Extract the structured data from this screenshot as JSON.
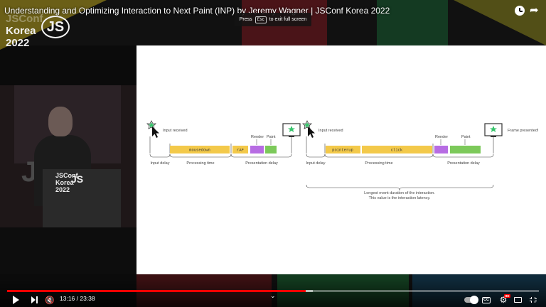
{
  "video": {
    "title": "Understanding and Optimizing Interaction to Next Paint (INP) by Jeremy Wagner | JSConf Korea 2022",
    "time": "13:16 / 23:38",
    "progress_played": 0.561,
    "progress_loaded": 0.575
  },
  "toast": {
    "press": "Press",
    "key": "Esc",
    "suffix": "to exit full screen"
  },
  "branding": {
    "logo_line1": "JSConf",
    "logo_line2": "Korea",
    "logo_line3": "2022",
    "logo_js": "JS"
  },
  "diagram": {
    "left": {
      "input_received": "Input received",
      "events": [
        "mousedown"
      ],
      "raf": "rAF",
      "render": "Render",
      "paint": "Paint",
      "input_delay": "Input delay",
      "processing_time": "Processing time",
      "presentation_delay": "Presentation delay"
    },
    "right": {
      "input_received": "Input received",
      "events": [
        "pointerup",
        "click"
      ],
      "render": "Render",
      "paint": "Paint",
      "frame_presented": "Frame presented!",
      "input_delay": "Input delay",
      "processing_time": "Processing time",
      "presentation_delay": "Presentation delay",
      "longest_line1": "Longest event duration of the interaction.",
      "longest_line2": "This value is the interaction latency."
    },
    "colors": {
      "event": "#f3c94a",
      "render": "#b76ce3",
      "paint": "#7cc95a",
      "star": "#36c46b",
      "bracket": "#444444"
    }
  },
  "icons": {
    "clock": "watch-later-icon",
    "share": "share-icon",
    "play": "play-icon",
    "next": "next-icon",
    "mute": "mute-icon",
    "chevron": "chevron-down-icon",
    "autoplay": "autoplay-toggle-icon",
    "cc": "captions-icon",
    "settings": "settings-icon",
    "cast": "cast-icon",
    "exit_fullscreen": "exit-fullscreen-icon"
  }
}
